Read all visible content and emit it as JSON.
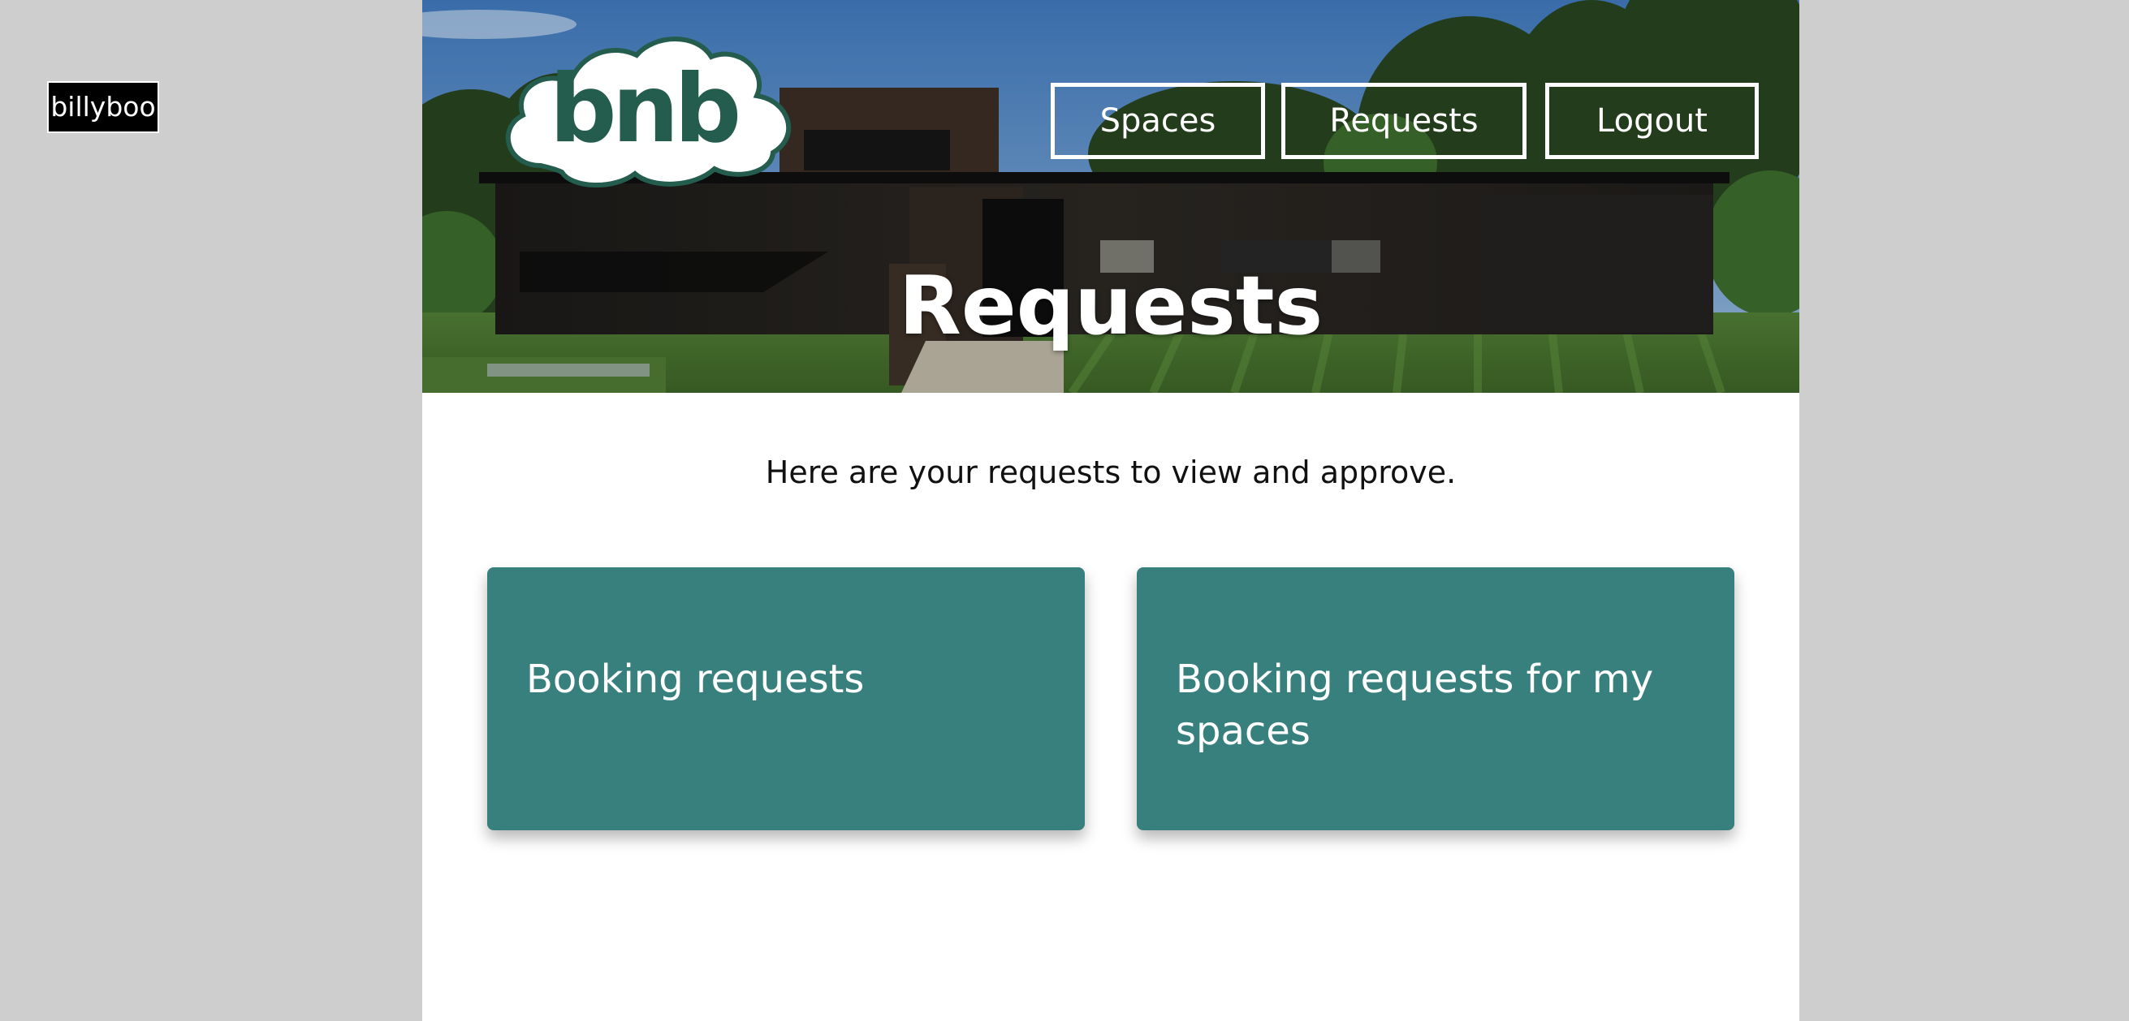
{
  "user": {
    "name": "billyboo"
  },
  "logo": {
    "text": "bnb"
  },
  "nav": {
    "spaces": "Spaces",
    "requests": "Requests",
    "logout": "Logout"
  },
  "page": {
    "title": "Requests",
    "intro": "Here are your requests to view and approve."
  },
  "cards": [
    {
      "label": "Booking requests"
    },
    {
      "label": "Booking requests for my spaces"
    }
  ],
  "colors": {
    "card": "#38807d",
    "logo": "#245c4e",
    "background": "#cecece"
  }
}
